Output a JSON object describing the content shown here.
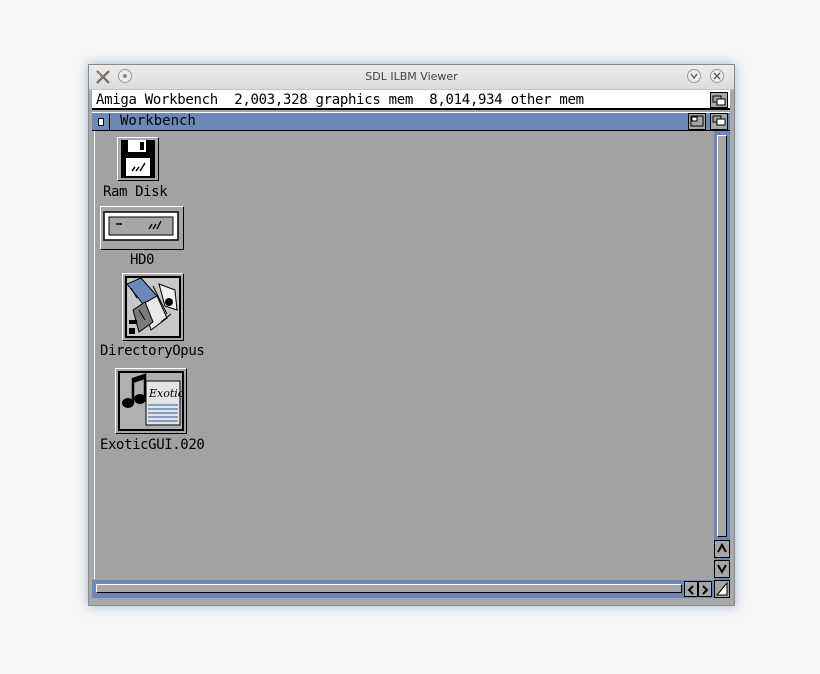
{
  "host": {
    "title": "SDL ILBM Viewer"
  },
  "screen": {
    "title_bar": "Amiga Workbench  2,003,328 graphics mem  8,014,934 other mem"
  },
  "workbench_window": {
    "title": "Workbench"
  },
  "icons": [
    {
      "label": "Ram Disk",
      "icon": "floppy-disk-icon"
    },
    {
      "label": "HD0",
      "icon": "hard-drive-icon"
    },
    {
      "label": "DirectoryOpus",
      "icon": "directory-opus-icon"
    },
    {
      "label": "ExoticGUI.020",
      "icon": "exotic-gui-icon"
    }
  ],
  "exotic_icon_text": "Exotic",
  "colors": {
    "amiga_blue": "#6a88b8",
    "amiga_gray": "#a6a6a6",
    "amiga_white": "#ffffff",
    "amiga_black": "#000000"
  }
}
